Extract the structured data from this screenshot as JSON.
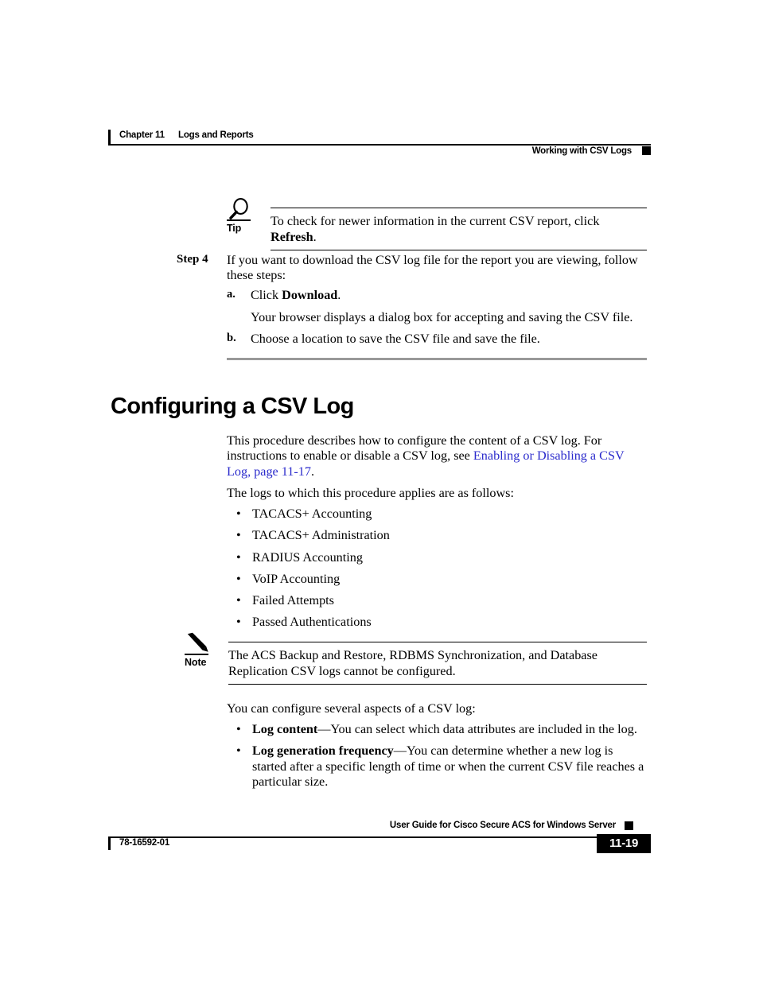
{
  "header": {
    "chapter": "Chapter 11",
    "chapter_title": "Logs and Reports",
    "section": "Working with CSV Logs"
  },
  "tip": {
    "icon": "magnifier-tip-icon",
    "label": "Tip",
    "text_before_bold": "To check for newer information in the current CSV report, click ",
    "bold": "Refresh",
    "text_after_bold": "."
  },
  "step4": {
    "label": "Step 4",
    "text": "If you want to download the CSV log file for the report you are viewing, follow these steps:",
    "substeps": [
      {
        "label": "a.",
        "text_before_bold": "Click ",
        "bold": "Download",
        "text_after_bold": "."
      },
      {
        "label": "b.",
        "text_before_bold": "Choose a location to save the CSV file and save the file.",
        "bold": "",
        "text_after_bold": ""
      }
    ],
    "substep_a_result": "Your browser displays a dialog box for accepting and saving the CSV file."
  },
  "heading": "Configuring a CSV Log",
  "intro": {
    "text_part1": "This procedure describes how to configure the content of a CSV log. For instructions to enable or disable a CSV log, see ",
    "link": "Enabling or Disabling a CSV Log, page 11-17",
    "text_part2": "."
  },
  "logs_intro": "The logs to which this procedure applies are as follows:",
  "logs_list": [
    "TACACS+ Accounting",
    "TACACS+ Administration",
    "RADIUS Accounting",
    "VoIP Accounting",
    "Failed Attempts",
    "Passed Authentications"
  ],
  "note": {
    "icon": "pencil-note-icon",
    "label": "Note",
    "text": "The ACS Backup and Restore, RDBMS Synchronization, and Database Replication CSV logs cannot be configured."
  },
  "aspects_intro": "You can configure several aspects of a CSV log:",
  "aspects_list": [
    {
      "bold": "Log content",
      "rest": "—You can select which data attributes are included in the log."
    },
    {
      "bold": "Log generation frequency",
      "rest": "—You can determine whether a new log is started after a specific length of time or when the current CSV file reaches a particular size."
    }
  ],
  "footer": {
    "guide_title": "User Guide for Cisco Secure ACS for Windows Server",
    "doc_number": "78-16592-01",
    "page_number": "11-19"
  },
  "bullet_glyph": "•",
  "colors": {
    "link": "#2b2bcc",
    "section_rule": "#999999",
    "ink": "#000000"
  }
}
